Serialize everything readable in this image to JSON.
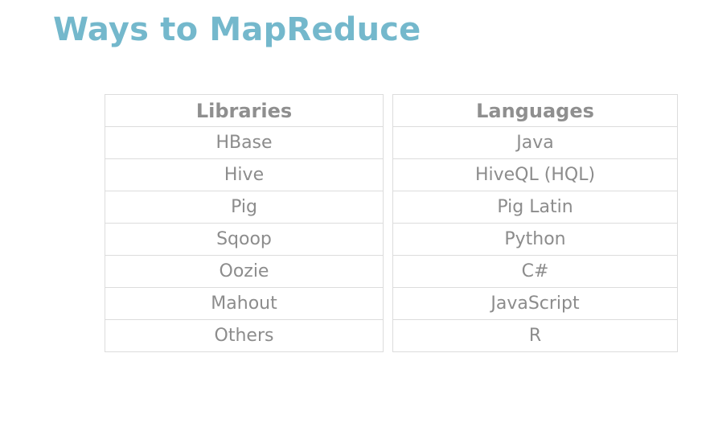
{
  "title": "Ways to MapReduce",
  "libraries": {
    "header": "Libraries",
    "rows": [
      "HBase",
      "Hive",
      "Pig",
      "Sqoop",
      "Oozie",
      "Mahout",
      "Others"
    ]
  },
  "languages": {
    "header": "Languages",
    "rows": [
      "Java",
      "HiveQL (HQL)",
      "Pig Latin",
      "Python",
      "C#",
      "JavaScript",
      "R"
    ]
  },
  "colors": {
    "title": "#74b8cc",
    "text": "#8c8c8c",
    "border": "#dcdcdc"
  }
}
